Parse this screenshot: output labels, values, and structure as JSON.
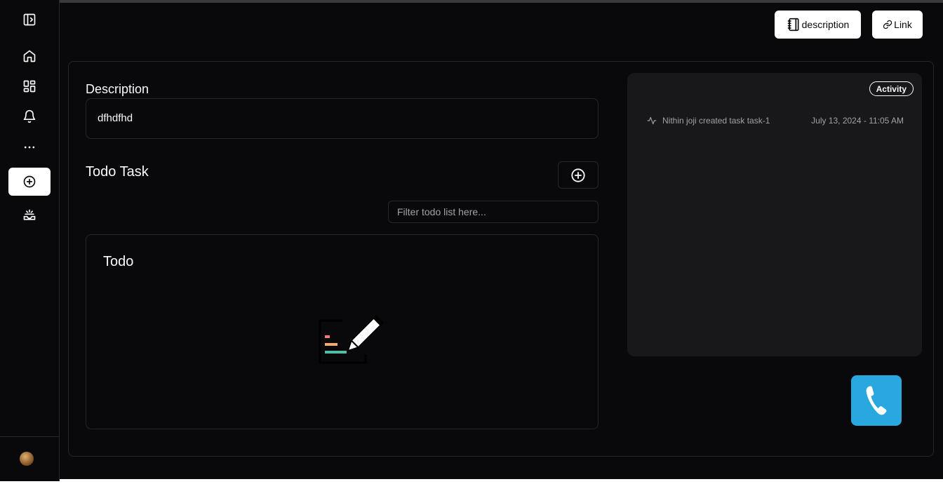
{
  "header": {
    "description_button": "description",
    "link_button": "Link"
  },
  "description": {
    "label": "Description",
    "value": "dfhdfhd"
  },
  "todo_task": {
    "label": "Todo Task",
    "filter_placeholder": "Filter todo list here...",
    "list_title": "Todo"
  },
  "activity": {
    "badge": "Activity",
    "entries": [
      {
        "text": "Nithin joji created task task-1",
        "time": "July 13, 2024 - 11:05 AM"
      }
    ]
  },
  "sidebar": {
    "items": [
      {
        "icon": "sidebar-toggle-icon"
      },
      {
        "icon": "home-icon"
      },
      {
        "icon": "dashboard-icon"
      },
      {
        "icon": "bell-icon"
      },
      {
        "icon": "more-icon"
      },
      {
        "icon": "plus-circle-icon",
        "active": true
      },
      {
        "icon": "inbox-icon"
      }
    ]
  },
  "colors": {
    "background": "#09090b",
    "border": "#27272a",
    "activity_panel": "#18181b",
    "call_button": "#29a8e0"
  }
}
